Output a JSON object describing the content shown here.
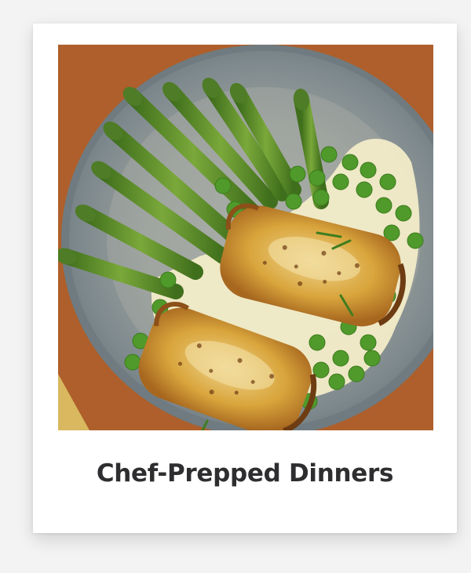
{
  "card": {
    "caption": "Chef-Prepped Dinners",
    "image_icon": "plated-dish-image"
  },
  "colors": {
    "page_background": "#f3f3f3",
    "card_background": "#ffffff",
    "caption_text": "#2e2e30",
    "table_wood": "#b8662f",
    "plate": "#8f9a9c",
    "asparagus": "#5f8f2e",
    "peas": "#4f9a2a",
    "sauce": "#f2ecc8",
    "crepe": "#d9a53c"
  }
}
